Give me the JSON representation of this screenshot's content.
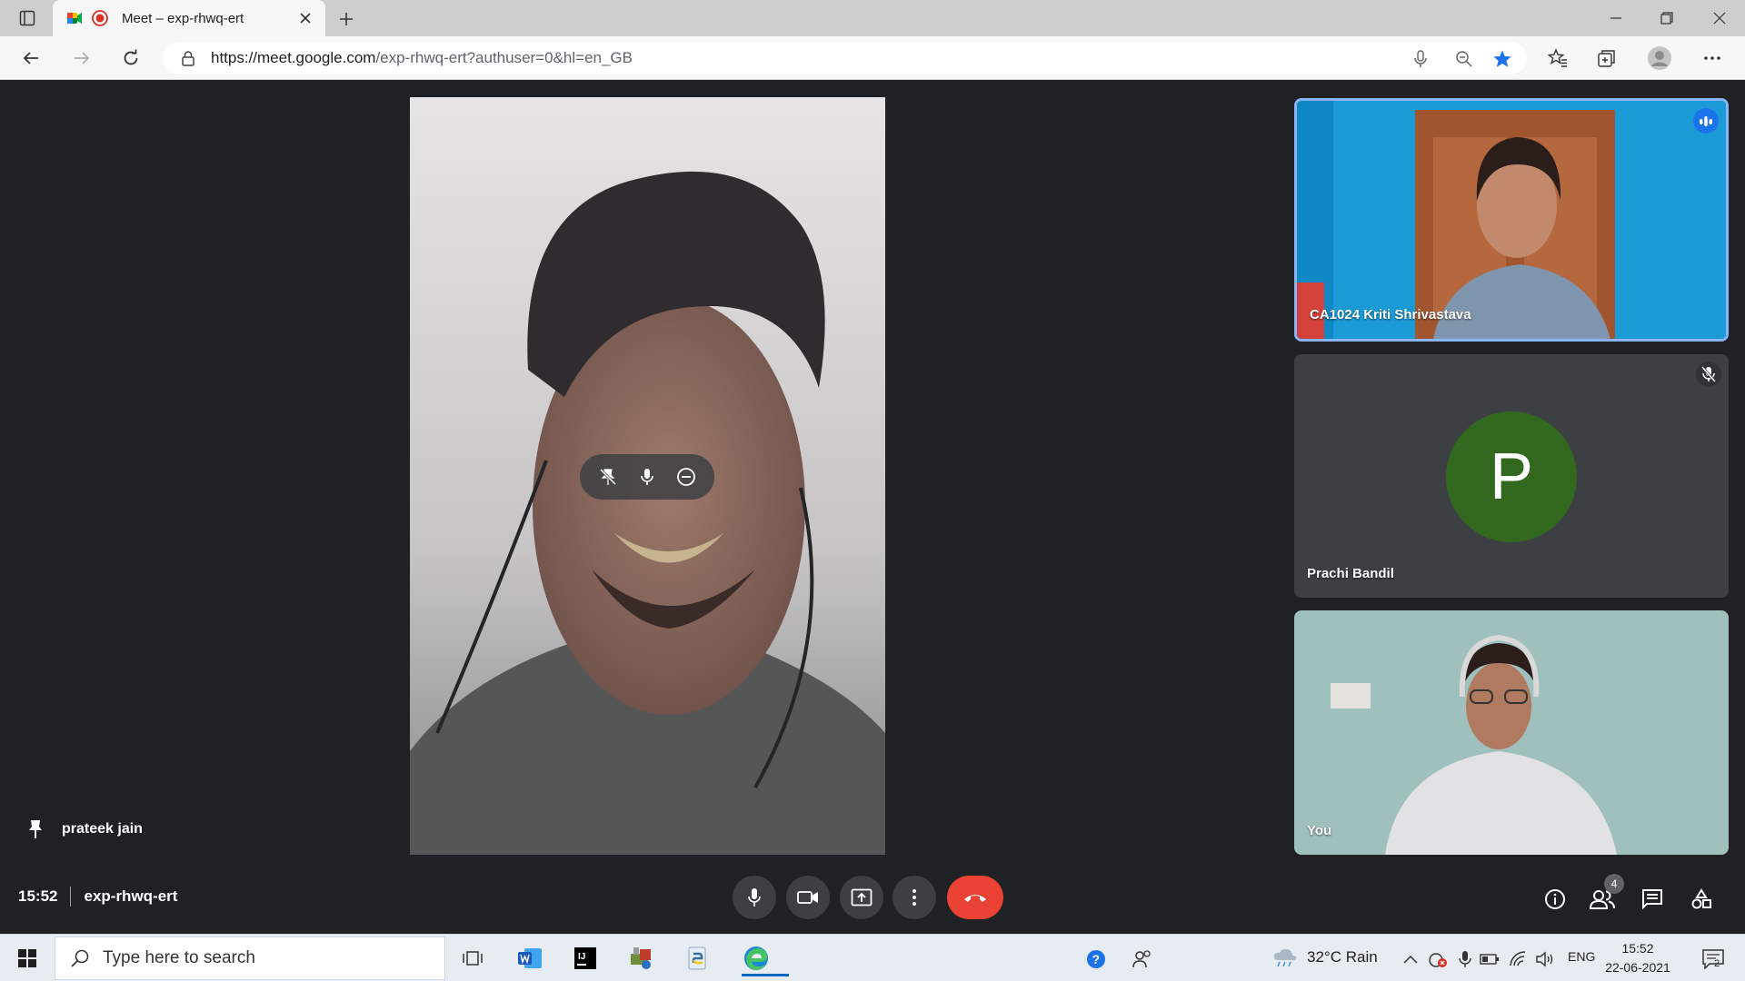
{
  "browser": {
    "tab_title": "Meet – exp-rhwq-ert",
    "url_host": "https://meet.google.com",
    "url_path": "/exp-rhwq-ert?authuser=0&hl=en_GB"
  },
  "meet": {
    "main_speaker_name": "prateek jain",
    "participants": [
      {
        "name": "CA1024 Kriti Shrivastava",
        "speaking": true
      },
      {
        "name": "Prachi Bandil",
        "initial": "P",
        "muted": true,
        "avatar_color": "#33691e"
      },
      {
        "name": "You"
      }
    ],
    "time": "15:52",
    "meeting_code": "exp-rhwq-ert",
    "people_count": "4",
    "end_call_color": "#ea4335"
  },
  "taskbar": {
    "search_placeholder": "Type here to search",
    "weather_text": "32°C  Rain",
    "language": "ENG",
    "time": "15:52",
    "date": "22-06-2021",
    "notification_count": "2",
    "apps": [
      "task-view-icon",
      "word-icon",
      "intellij-icon",
      "app-icon",
      "python-icon",
      "edge-icon"
    ]
  }
}
